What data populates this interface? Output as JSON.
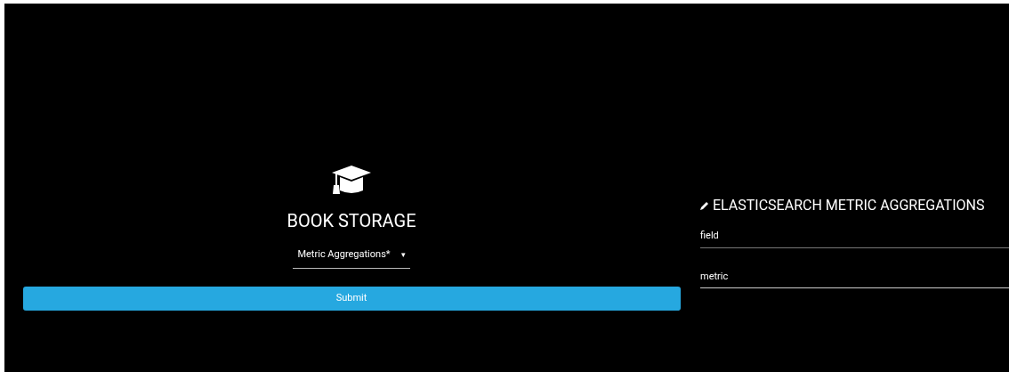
{
  "brand": {
    "title": "BOOK STORAGE"
  },
  "dropdown": {
    "value": "Metric Aggregations*",
    "caret": "▾"
  },
  "submit": {
    "label": "Submit"
  },
  "panel": {
    "heading": "ELASTICSEARCH METRIC AGGREGATIONS",
    "fields": [
      {
        "placeholder": "field"
      },
      {
        "placeholder": "metric"
      }
    ]
  }
}
